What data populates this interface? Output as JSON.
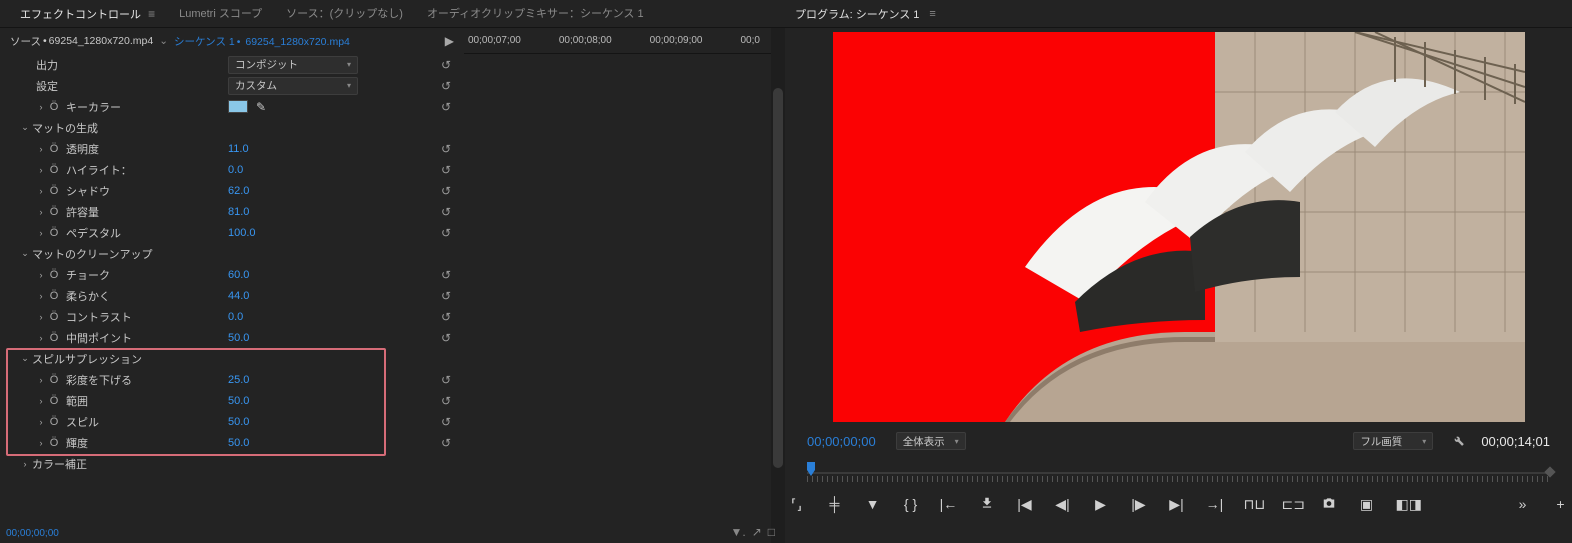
{
  "tabs": {
    "effect_controls": "エフェクトコントロール",
    "lumetri_scopes": "Lumetri スコープ",
    "source": "ソース：(クリップなし)",
    "audio_mixer": "オーディオクリップミキサー：シーケンス 1"
  },
  "source_row": {
    "source_prefix": "ソース",
    "clip_name": "69254_1280x720.mp4",
    "sequence_label": "シーケンス",
    "seq_num": "1",
    "seq_clip": "69254_1280x720.mp4"
  },
  "timeline_ticks": [
    "00;00;07;00",
    "00;00;08;00",
    "00;00;09;00",
    "00;0"
  ],
  "properties": {
    "output": {
      "label": "出力",
      "value": "コンポジット"
    },
    "setting": {
      "label": "設定",
      "value": "カスタム"
    },
    "key_color": {
      "label": "キーカラー"
    },
    "matte_gen": {
      "label": "マットの生成"
    },
    "transparency": {
      "label": "透明度",
      "value": "11.0"
    },
    "highlight": {
      "label": "ハイライト：",
      "value": "0.0"
    },
    "shadow": {
      "label": "シャドウ",
      "value": "62.0"
    },
    "tolerance": {
      "label": "許容量",
      "value": "81.0"
    },
    "pedestal": {
      "label": "ペデスタル",
      "value": "100.0"
    },
    "matte_cleanup": {
      "label": "マットのクリーンアップ"
    },
    "choke": {
      "label": "チョーク",
      "value": "60.0"
    },
    "soften": {
      "label": "柔らかく",
      "value": "44.0"
    },
    "contrast": {
      "label": "コントラスト",
      "value": "0.0"
    },
    "midpoint": {
      "label": "中間ポイント",
      "value": "50.0"
    },
    "spill_suppression": {
      "label": "スピルサプレッション"
    },
    "desaturate": {
      "label": "彩度を下げる",
      "value": "25.0"
    },
    "range": {
      "label": "範囲",
      "value": "50.0"
    },
    "spill": {
      "label": "スピル",
      "value": "50.0"
    },
    "luma": {
      "label": "輝度",
      "value": "50.0"
    },
    "color_correct": {
      "label": "カラー補正"
    }
  },
  "footer_time": "00;00;00;00",
  "program": {
    "title": "プログラム: シーケンス 1",
    "time_current": "00;00;00;00",
    "time_total": "00;00;14;01",
    "fit_label": "全体表示",
    "res_label": "フル画質"
  }
}
